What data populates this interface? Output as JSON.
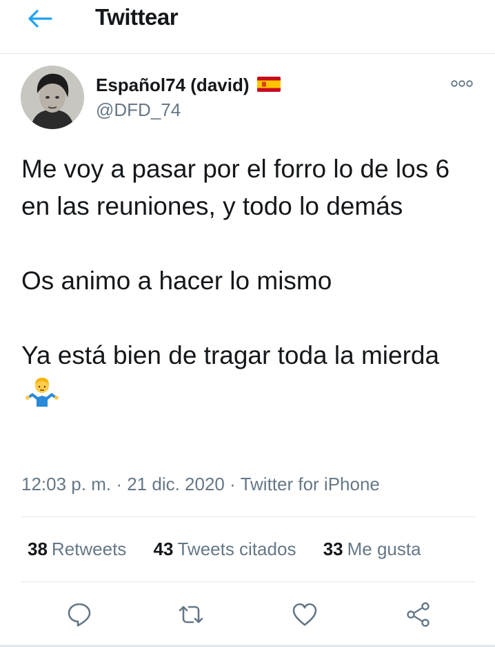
{
  "header": {
    "title": "Twittear",
    "back_icon": "arrow-left-icon"
  },
  "tweet": {
    "author_name": "Español74 (david)",
    "author_handle": "@DFD_74",
    "flag_icon": "spain-flag-icon",
    "paragraphs": [
      "Me voy a pasar por el forro lo de los 6 en las reuniones, y todo lo demás",
      "Os animo a hacer lo mismo",
      "Ya está bien de tragar toda la mierda"
    ],
    "emoji_icon": "person-shrugging-emoji",
    "time": "12:03 p. m.",
    "separator": "·",
    "date": "21 dic. 2020",
    "source": "Twitter for iPhone"
  },
  "stats": {
    "retweets_count": "38",
    "retweets_label": "Retweets",
    "quotes_count": "43",
    "quotes_label": "Tweets citados",
    "likes_count": "33",
    "likes_label": "Me gusta"
  },
  "actions": [
    "reply-icon",
    "retweet-icon",
    "like-icon",
    "share-icon"
  ],
  "colors": {
    "accent": "#1da1f2",
    "text": "#14171a",
    "secondary": "#657786",
    "divider": "#e1e8ed"
  }
}
